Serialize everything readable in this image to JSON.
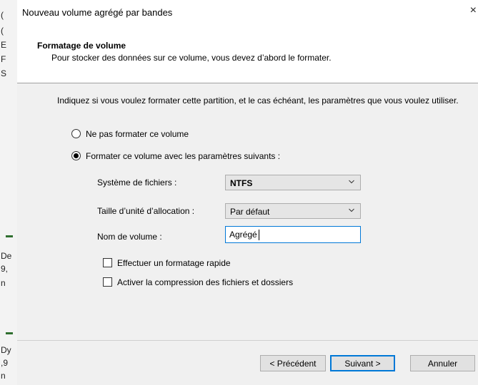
{
  "dialog": {
    "title": "Nouveau volume agrégé par bandes",
    "close_glyph": "×"
  },
  "header": {
    "title": "Formatage de volume",
    "description": "Pour stocker des données sur ce volume, vous devez d’abord le formater."
  },
  "content": {
    "intro": "Indiquez si vous voulez formater cette partition, et le cas échéant, les paramètres que vous voulez utiliser.",
    "options": {
      "no_format": {
        "label": "Ne pas formater ce volume",
        "checked": false
      },
      "format": {
        "label": "Formater ce volume avec les paramètres suivants :",
        "checked": true
      }
    },
    "filesystem": {
      "label": "Système de fichiers :",
      "value": "NTFS"
    },
    "allocation": {
      "label": "Taille d’unité d’allocation :",
      "value": "Par défaut"
    },
    "volume_name": {
      "label": "Nom de volume :",
      "value": "Agrégé"
    },
    "quick_format": {
      "label": "Effectuer un formatage rapide",
      "checked": false
    },
    "compression": {
      "label": "Activer la compression des fichiers et dossiers",
      "checked": false
    }
  },
  "buttons": {
    "back": "< Précédent",
    "next": "Suivant >",
    "cancel": "Annuler"
  },
  "background_fragments": [
    "(",
    "(",
    "E",
    "F",
    "S",
    "De",
    "9,",
    "n",
    "Dy",
    ",9",
    "n"
  ]
}
